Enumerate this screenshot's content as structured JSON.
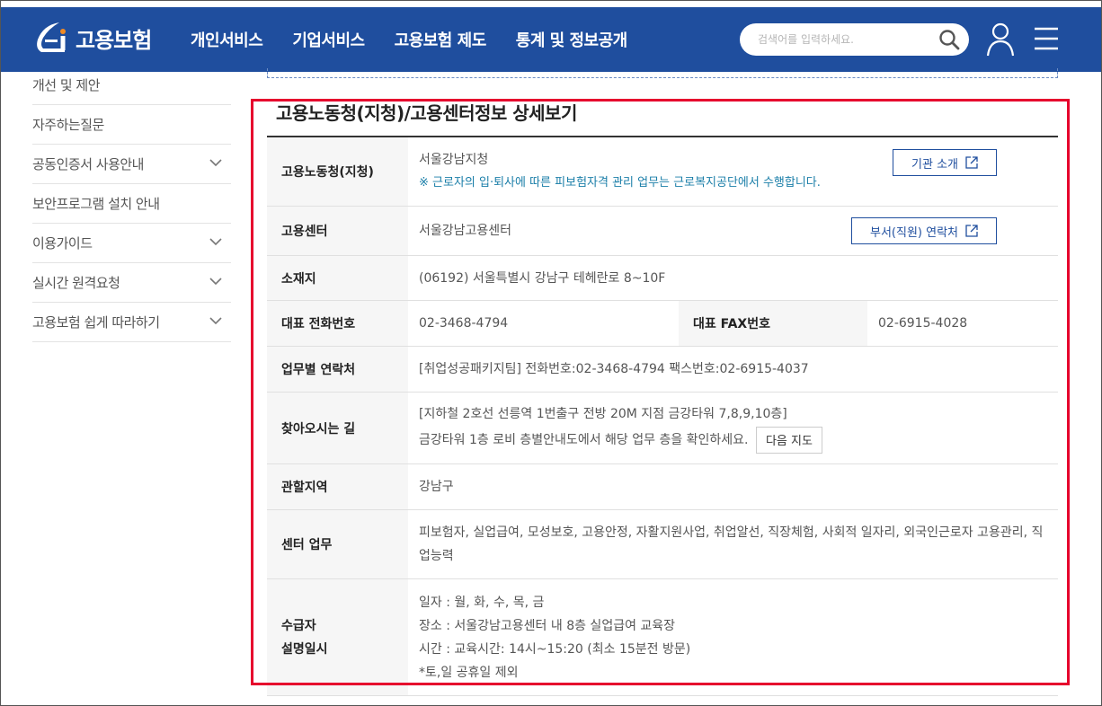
{
  "header": {
    "logo_text": "고용보험",
    "nav": [
      "개인서비스",
      "기업서비스",
      "고용보험 제도",
      "통계 및 정보공개"
    ],
    "search_placeholder": "검색어를 입력하세요."
  },
  "sidebar": {
    "items": [
      {
        "label": "개선 및 제안",
        "expandable": false
      },
      {
        "label": "자주하는질문",
        "expandable": false
      },
      {
        "label": "공동인증서 사용안내",
        "expandable": true
      },
      {
        "label": "보안프로그램 설치 안내",
        "expandable": false
      },
      {
        "label": "이용가이드",
        "expandable": true
      },
      {
        "label": "실시간 원격요청",
        "expandable": true
      },
      {
        "label": "고용보험 쉽게 따라하기",
        "expandable": true
      }
    ]
  },
  "content": {
    "title": "고용노동청(지청)/고용센터정보 상세보기",
    "office": {
      "label": "고용노동청(지청)",
      "value": "서울강남지청",
      "note": "※ 근로자의 입·퇴사에 따른 피보험자격 관리 업무는 근로복지공단에서 수행합니다.",
      "button": "기관 소개"
    },
    "center": {
      "label": "고용센터",
      "value": "서울강남고용센터",
      "button": "부서(직원) 연락처"
    },
    "address": {
      "label": "소재지",
      "value": "(06192) 서울특별시 강남구 테헤란로 8~10F"
    },
    "phone": {
      "label": "대표 전화번호",
      "value": "02-3468-4794",
      "fax_label": "대표 FAX번호",
      "fax_value": "02-6915-4028"
    },
    "contacts": {
      "label": "업무별 연락처",
      "value": "[취업성공패키지팀] 전화번호:02-3468-4794 팩스번호:02-6915-4037"
    },
    "directions": {
      "label": "찾아오시는 길",
      "line1": "[지하철 2호선 선릉역 1번출구 전방 20M 지점 금강타워 7,8,9,10층]",
      "line2": "금강타워 1층 로비 층별안내도에서 해당 업무 층을 확인하세요.",
      "button": "다음 지도"
    },
    "region": {
      "label": "관할지역",
      "value": "강남구"
    },
    "services": {
      "label": "센터 업무",
      "value": "피보험자, 실업급여, 모성보호, 고용안정, 자활지원사업, 취업알선, 직장체험, 사회적 일자리, 외국인근로자 고용관리, 직업능력"
    },
    "briefing": {
      "label_line1": "수급자",
      "label_line2": "설명일시",
      "lines": [
        "일자 : 월, 화, 수, 목, 금",
        "장소 : 서울강남고용센터 내 8층 실업급여 교육장",
        "시간 : 교육시간: 14시~15:20 (최소 15분전 방문)",
        "*토,일 공휴일 제외"
      ]
    }
  },
  "colors": {
    "header_bg": "#1f4e9e",
    "highlight": "#e6002d",
    "note": "#1a7ea8"
  }
}
